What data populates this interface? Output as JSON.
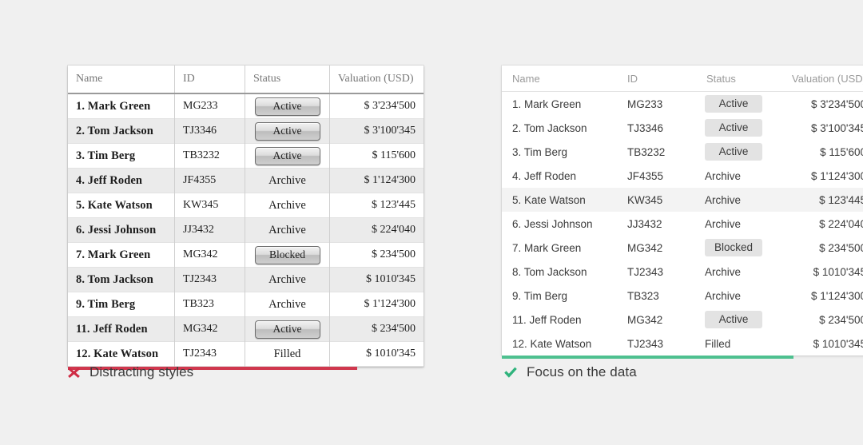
{
  "page": {
    "background_color": "#f0f0f0"
  },
  "columns": [
    "Name",
    "ID",
    "Status",
    "Valuation (USD)"
  ],
  "rows": [
    {
      "name": "1. Mark Green",
      "id": "MG233",
      "status": "Active",
      "badge": true,
      "valuation": "$ 3'234'500"
    },
    {
      "name": "2. Tom Jackson",
      "id": "TJ3346",
      "status": "Active",
      "badge": true,
      "valuation": "$ 3'100'345"
    },
    {
      "name": "3. Tim Berg",
      "id": "TB3232",
      "status": "Active",
      "badge": true,
      "valuation": "$ 115'600"
    },
    {
      "name": "4. Jeff Roden",
      "id": "JF4355",
      "status": "Archive",
      "badge": false,
      "valuation": "$ 1'124'300"
    },
    {
      "name": "5. Kate Watson",
      "id": "KW345",
      "status": "Archive",
      "badge": false,
      "valuation": "$ 123'445"
    },
    {
      "name": "6. Jessi Johnson",
      "id": "JJ3432",
      "status": "Archive",
      "badge": false,
      "valuation": "$ 224'040"
    },
    {
      "name": "7. Mark Green",
      "id": "MG342",
      "status": "Blocked",
      "badge": true,
      "valuation": "$ 234'500"
    },
    {
      "name": "8. Tom Jackson",
      "id": "TJ2343",
      "status": "Archive",
      "badge": false,
      "valuation": "$ 1010'345"
    },
    {
      "name": "9. Tim Berg",
      "id": "TB323",
      "status": "Archive",
      "badge": false,
      "valuation": "$ 1'124'300"
    },
    {
      "name": "11. Jeff Roden",
      "id": "MG342",
      "status": "Active",
      "badge": true,
      "valuation": "$ 234'500"
    },
    {
      "name": "12. Kate Watson",
      "id": "TJ2343",
      "status": "Filled",
      "badge": false,
      "valuation": "$ 1010'345"
    }
  ],
  "bad_panel": {
    "accent_color": "#d0384e",
    "caption": "Distracting styles",
    "icon": "cross-mark-icon",
    "icon_color": "#cf2c45",
    "striped_rows": true,
    "column_dividers": true
  },
  "good_panel": {
    "accent_color": "#4ec08f",
    "caption": "Focus on the data",
    "icon": "check-mark-icon",
    "icon_color": "#2fb37c",
    "highlighted_row_index": 4,
    "striped_rows": false,
    "column_dividers": false
  }
}
